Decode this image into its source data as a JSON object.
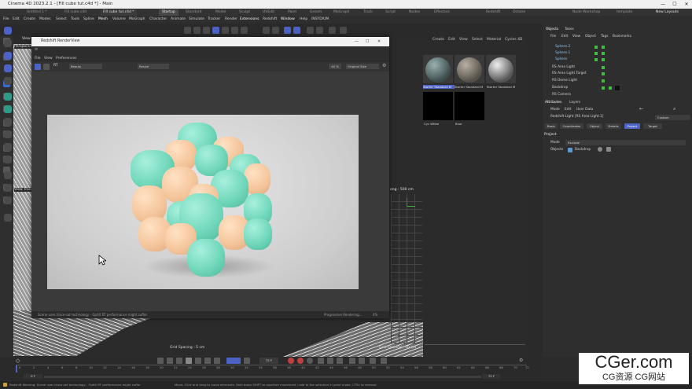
{
  "app": {
    "title": "Cinema 4D 2023.2.1 - [Fill cube tut.c4d *] - Main",
    "window_controls": [
      "—",
      "☐",
      "✕"
    ]
  },
  "doc_tabs": [
    "Untitled 1 *",
    "Fill cube.c4d",
    "Fill cube tut.c4d *"
  ],
  "layout_tabs": [
    "Startup",
    "Standard",
    "Model",
    "Sculpt",
    "UVEdit",
    "Paint",
    "Groom",
    "MoGraph",
    "Track",
    "Script",
    "Nodes",
    "Effectors",
    "Redshift",
    "Octane",
    "Node Workshop",
    "template"
  ],
  "new_layouts_label": "New Layouts",
  "menu": [
    "File",
    "Edit",
    "Create",
    "Modes",
    "Select",
    "Tools",
    "Spline",
    "Mesh",
    "Volume",
    "MoGraph",
    "Character",
    "Animate",
    "Simulate",
    "Tracker",
    "Render",
    "Extensions",
    "Redshift",
    "Window",
    "Help",
    "INSYDIUM"
  ],
  "viewport": {
    "menu": [
      "View"
    ],
    "label": "Perspective",
    "view_transform": "View Trans",
    "grid_spacing_left": "Grid Spacing : 5 cm",
    "grid_spacing_right": "Grid Spacing : 50 cm",
    "focal_label": "ong : 500 cm"
  },
  "render_view": {
    "title": "Redshift RenderView",
    "menu": [
      "File",
      "View",
      "Preferences"
    ],
    "toolbar": {
      "rt_label": "RT",
      "beauty": "Beauty",
      "resize": "Resize",
      "zoom": "40 %",
      "size": "Original Size"
    },
    "status_left": "Scene uses trace-set technology - OptiX RT performance might suffer",
    "status_right": "Progressive Rendering...",
    "status_pct": "4%"
  },
  "materials": {
    "menu": [
      "Create",
      "Edit",
      "View",
      "Select",
      "Material",
      "Cycles 4D"
    ],
    "items": [
      {
        "name": "Starter Standard M",
        "ball": "#4a5a5a"
      },
      {
        "name": "Starter Standard M",
        "ball": "#6a6a66"
      },
      {
        "name": "Starter Standard M",
        "ball": "#888888"
      },
      {
        "name": "Cyc White",
        "ball": "#000000"
      },
      {
        "name": "Blue",
        "ball": "#000000"
      }
    ]
  },
  "objects": {
    "tabs": [
      "Objects",
      "Takes"
    ],
    "menu": [
      "File",
      "Edit",
      "View",
      "Object",
      "Tags",
      "Bookmarks"
    ],
    "rows": [
      {
        "name": "Sphere.2",
        "color": "#5b9bd5"
      },
      {
        "name": "Sphere.1",
        "color": "#5b9bd5"
      },
      {
        "name": "Sphere",
        "color": "#5b9bd5"
      },
      {
        "name": "RS Area Light",
        "color": "#d0d0d0"
      },
      {
        "name": "RS Area Light.Target",
        "color": "#d0d0d0"
      },
      {
        "name": "RS Dome Light",
        "color": "#d0d0d0"
      },
      {
        "name": "Backdrop",
        "color": "#d0d0d0"
      },
      {
        "name": "RS Camera",
        "color": "#d0d0d0"
      }
    ]
  },
  "attributes": {
    "tabs": [
      "Attributes",
      "Layers"
    ],
    "menu": [
      "Mode",
      "Edit",
      "User Data"
    ],
    "subtitle": "Redshift Light [RS Area Light.1]",
    "preset": "Custom",
    "buttons": [
      "Basic",
      "Coordinates",
      "Object",
      "Details",
      "Project",
      "Target"
    ],
    "active_button": "Project",
    "section": "Project",
    "mode_label": "Mode",
    "mode_value": "Exclude",
    "objects_label": "Objects",
    "objects_value": "Backdrop"
  },
  "timeline": {
    "frame_current": "0 F",
    "frame_end": "72 F",
    "frame_field": "72 F",
    "ticks": [
      "0",
      "2",
      "4",
      "6",
      "8",
      "10",
      "12",
      "14",
      "16",
      "18",
      "20",
      "22",
      "24",
      "26",
      "28",
      "30",
      "32",
      "34",
      "36",
      "38",
      "40",
      "42",
      "44",
      "46",
      "48",
      "50",
      "52",
      "54",
      "56",
      "58",
      "60",
      "62",
      "64",
      "66",
      "68",
      "70",
      "72"
    ]
  },
  "status": {
    "warning": "Redshift Warning: Scene uses trace-set technology - OptiX RT performance might suffer",
    "hint": "Move: Click and drag to move elements. Hold down SHIFT to quantize movement / add to the selection in point mode, CTRL to remove."
  },
  "watermark": {
    "main": "CGer.com",
    "sub": "CG资源 CG网站"
  },
  "colors": {
    "accent": "#4c62c4",
    "mint": "#72d8bb",
    "peach": "#f4c49a"
  }
}
